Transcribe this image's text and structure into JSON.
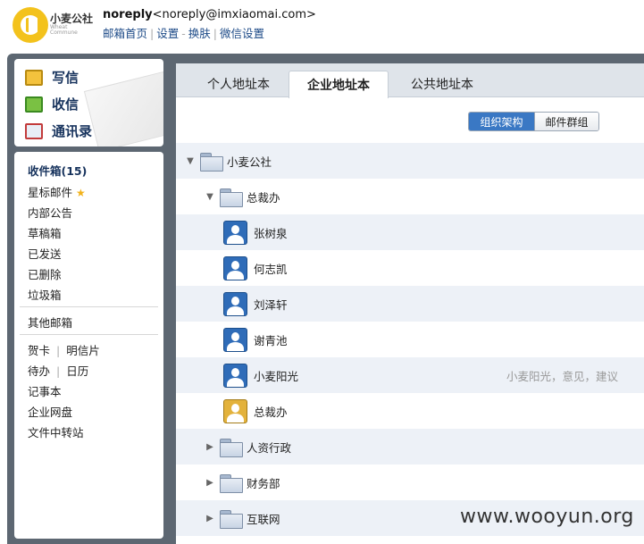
{
  "brand": {
    "name": "小麦公社",
    "sub": "Wheat Commune"
  },
  "account": {
    "user": "noreply",
    "email": "<noreply@imxiaomai.com>"
  },
  "top_links": [
    "邮箱首页",
    "设置",
    "换肤",
    "微信设置"
  ],
  "quick": {
    "write": "写信",
    "receive": "收信",
    "contacts": "通讯录"
  },
  "folders": {
    "inbox": "收件箱(15)",
    "starred": "星标邮件",
    "notice": "内部公告",
    "drafts": "草稿箱",
    "sent": "已发送",
    "deleted": "已删除",
    "spam": "垃圾箱",
    "other": "其他邮箱",
    "card": "贺卡",
    "postcard": "明信片",
    "todo": "待办",
    "calendar": "日历",
    "notes": "记事本",
    "disk": "企业网盘",
    "transfer": "文件中转站"
  },
  "tabs": [
    "个人地址本",
    "企业地址本",
    "公共地址本"
  ],
  "segments": [
    "组织架构",
    "邮件群组"
  ],
  "tree": {
    "root": "小麦公社",
    "dept": "总裁办",
    "members": [
      "张树泉",
      "何志凯",
      "刘泽轩",
      "谢青池",
      "小麦阳光",
      "总裁办"
    ],
    "member_note": "小麦阳光，意见，建议",
    "other_depts": [
      "人资行政",
      "财务部",
      "互联网"
    ]
  },
  "watermark": "www.wooyun.org",
  "colors": {
    "accent": "#3a78c4",
    "link": "#1c4a87",
    "frame": "#5d6772",
    "row_shade": "#edf1f7"
  }
}
